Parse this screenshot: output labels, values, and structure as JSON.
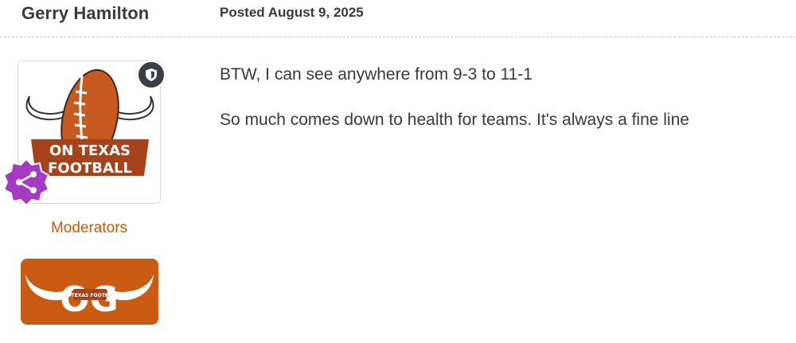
{
  "post": {
    "author": "Gerry Hamilton",
    "date": "Posted August 9, 2025",
    "lines": [
      "BTW, I can see anywhere from 9-3 to 11-1",
      "So much comes down to health for teams. It's always a fine line"
    ]
  },
  "avatar": {
    "logo_line1": "ON TEXAS",
    "logo_line2": "FOOTBALL"
  },
  "member": {
    "group": "Moderators",
    "og_badge_text": "OG",
    "og_badge_subtext": "ON TEXAS FOOTBALL"
  },
  "colors": {
    "accent": "#c25b0f",
    "badge_purple": "#a43bc2",
    "shield_bg": "#3a3f47",
    "og_bg": "#c95b12"
  },
  "icons": {
    "moderator": "shield-icon",
    "share": "share-icon"
  }
}
